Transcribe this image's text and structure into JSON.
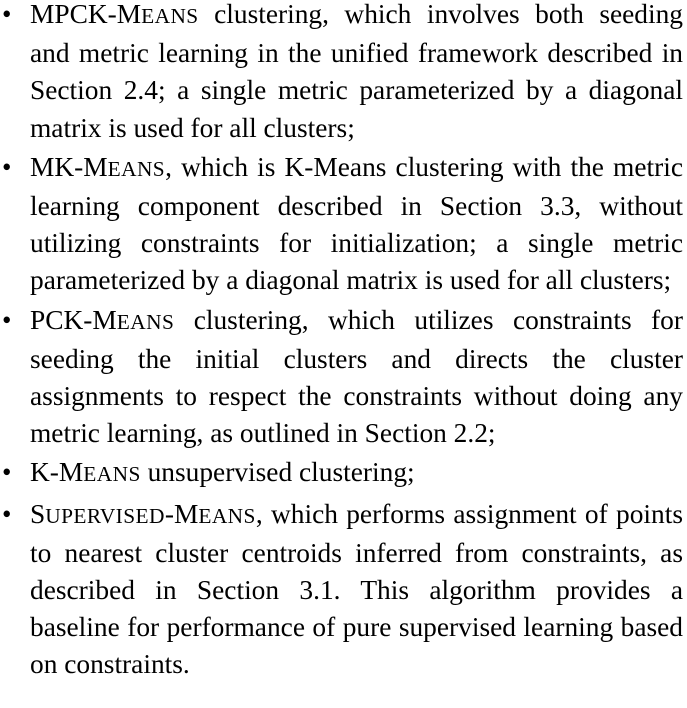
{
  "items": [
    {
      "name_lead": "MPCK-M",
      "name_small": "EANS",
      "name_rest": "",
      "text": " clustering, which involves both seed­ing and metric learning in the unified framework de­scribed in Section 2.4; a single metric parameterized by a diagonal matrix is used for all clusters;"
    },
    {
      "name_lead": "MK-M",
      "name_small": "EANS",
      "name_rest": "",
      "text": ", which is K-Means clustering with the metric learning component described in Section 3.3, without utilizing constraints for initialization; a single metric parameterized by a diagonal matrix is used for all clusters;"
    },
    {
      "name_lead": "PCK-M",
      "name_small": "EANS",
      "name_rest": "",
      "text": " clustering, which utilizes constraints for seeding the initial clusters and directs the cluster assignments to respect the constraints without doing any metric learning, as outlined in Section 2.2;"
    },
    {
      "name_lead": "K-M",
      "name_small": "EANS",
      "name_rest": "",
      "text": " unsupervised clustering;"
    },
    {
      "name_lead": "S",
      "name_small": "UPERVISED",
      "name_rest": "-",
      "name_lead2": "M",
      "name_small2": "EANS",
      "text": ", which performs assignment of points to nearest cluster centroids inferred from con­straints, as described in Section 3.1.  This algorithm provides a baseline for performance of pure super­vised learning based on constraints."
    }
  ]
}
